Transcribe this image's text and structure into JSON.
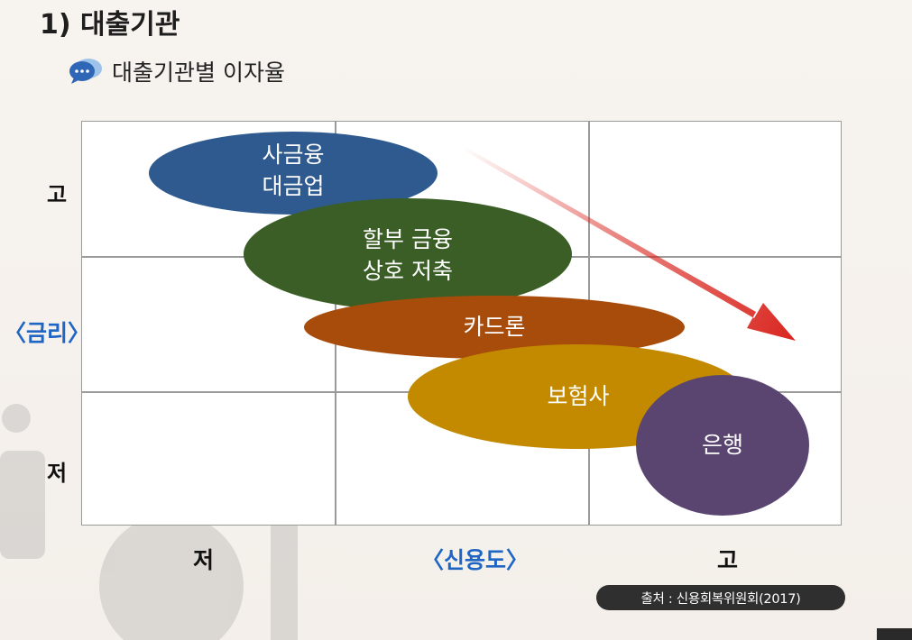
{
  "title": "1) 대출기관",
  "subtitle": "대출기관별 이자율",
  "subtitle_icon": "speech-bubble-icon",
  "y_axis": {
    "title": "〈금리〉",
    "high": "고",
    "low": "저"
  },
  "x_axis": {
    "title": "〈신용도〉",
    "low": "저",
    "high": "고"
  },
  "institutions": [
    {
      "id": "lender",
      "lines": [
        "사금융",
        "대금업"
      ],
      "color": "#2f5a8f"
    },
    {
      "id": "installment",
      "lines": [
        "할부 금융",
        "상호 저축"
      ],
      "color": "#3a5e25"
    },
    {
      "id": "card",
      "lines": [
        "카드론"
      ],
      "color": "#a84c0c"
    },
    {
      "id": "insurance",
      "lines": [
        "보험사"
      ],
      "color": "#c38a00"
    },
    {
      "id": "bank",
      "lines": [
        "은행"
      ],
      "color": "#5a4570"
    }
  ],
  "trend_arrow": {
    "color": "#d9261f",
    "direction": "down-right"
  },
  "source": "출처 : 신용회복위원회(2017)",
  "accent_color": "#1f66c4"
}
